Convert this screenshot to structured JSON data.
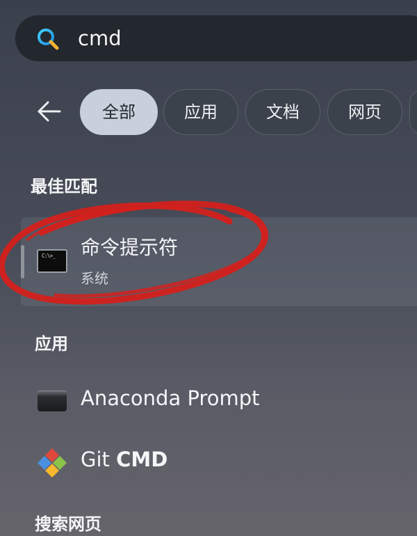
{
  "search": {
    "query": "cmd"
  },
  "filters": {
    "tabs": [
      {
        "label": "全部",
        "active": true
      },
      {
        "label": "应用",
        "active": false
      },
      {
        "label": "文档",
        "active": false
      },
      {
        "label": "网页",
        "active": false
      }
    ]
  },
  "best_match": {
    "heading": "最佳匹配",
    "item": {
      "title": "命令提示符",
      "subtitle": "系统",
      "icon": "command-prompt-icon"
    }
  },
  "apps": {
    "heading": "应用",
    "items": [
      {
        "title": "Anaconda Prompt",
        "icon": "anaconda-prompt-icon"
      },
      {
        "title_prefix": "Git ",
        "title_bold": "CMD",
        "icon": "git-icon"
      }
    ]
  },
  "web_search": {
    "heading": "搜索网页"
  },
  "colors": {
    "annotation": "#d4201c",
    "active_chip": "#c8d0db"
  }
}
